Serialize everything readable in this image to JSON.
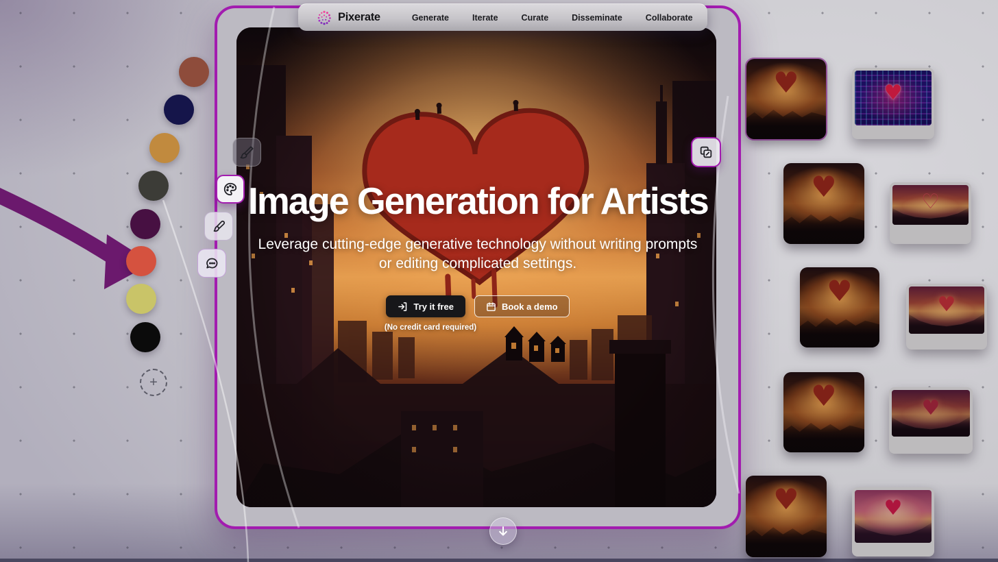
{
  "nav": {
    "brand": "Pixerate",
    "items": [
      {
        "id": "generate",
        "label": "Generate"
      },
      {
        "id": "iterate",
        "label": "Iterate"
      },
      {
        "id": "curate",
        "label": "Curate"
      },
      {
        "id": "disseminate",
        "label": "Disseminate"
      },
      {
        "id": "collaborate",
        "label": "Collaborate"
      }
    ]
  },
  "hero": {
    "title": "Image Generation for Artists",
    "subtitle": "Leverage cutting-edge generative technology without writing prompts or editing complicated settings.",
    "primary_cta": {
      "label": "Try it free",
      "icon": "login-icon"
    },
    "secondary_cta": {
      "label": "Book a demo",
      "icon": "calendar-icon"
    },
    "cta_note": "(No credit card required)"
  },
  "canvas_tools": [
    {
      "icon": "paintbrush-icon",
      "selected": false
    },
    {
      "icon": "palette-icon",
      "selected": true
    },
    {
      "icon": "pen-icon",
      "selected": false
    },
    {
      "icon": "chat-icon",
      "selected": false
    }
  ],
  "copy_tool": {
    "icon": "copy-icon"
  },
  "color_palette": {
    "swatches": [
      "#8e4c3b",
      "#15154a",
      "#c18a3e",
      "#3c3c37",
      "#471042",
      "#d5523f",
      "#c9c468",
      "#0b0b0b"
    ],
    "add_swatch_label": "+"
  },
  "accent_colors": {
    "card_border": "#a21caf",
    "arrow": "#6b196d"
  },
  "gallery": {
    "items": [
      {
        "variant": "city-square"
      },
      {
        "variant": "neon-card"
      },
      {
        "variant": "city-square"
      },
      {
        "variant": "outline-card"
      },
      {
        "variant": "city-square"
      },
      {
        "variant": "pixel-card"
      },
      {
        "variant": "city-square"
      },
      {
        "variant": "valley-card"
      },
      {
        "variant": "city-square"
      },
      {
        "variant": "pink-card"
      }
    ]
  },
  "scroll_hint": {
    "icon": "down-arrow-icon"
  }
}
